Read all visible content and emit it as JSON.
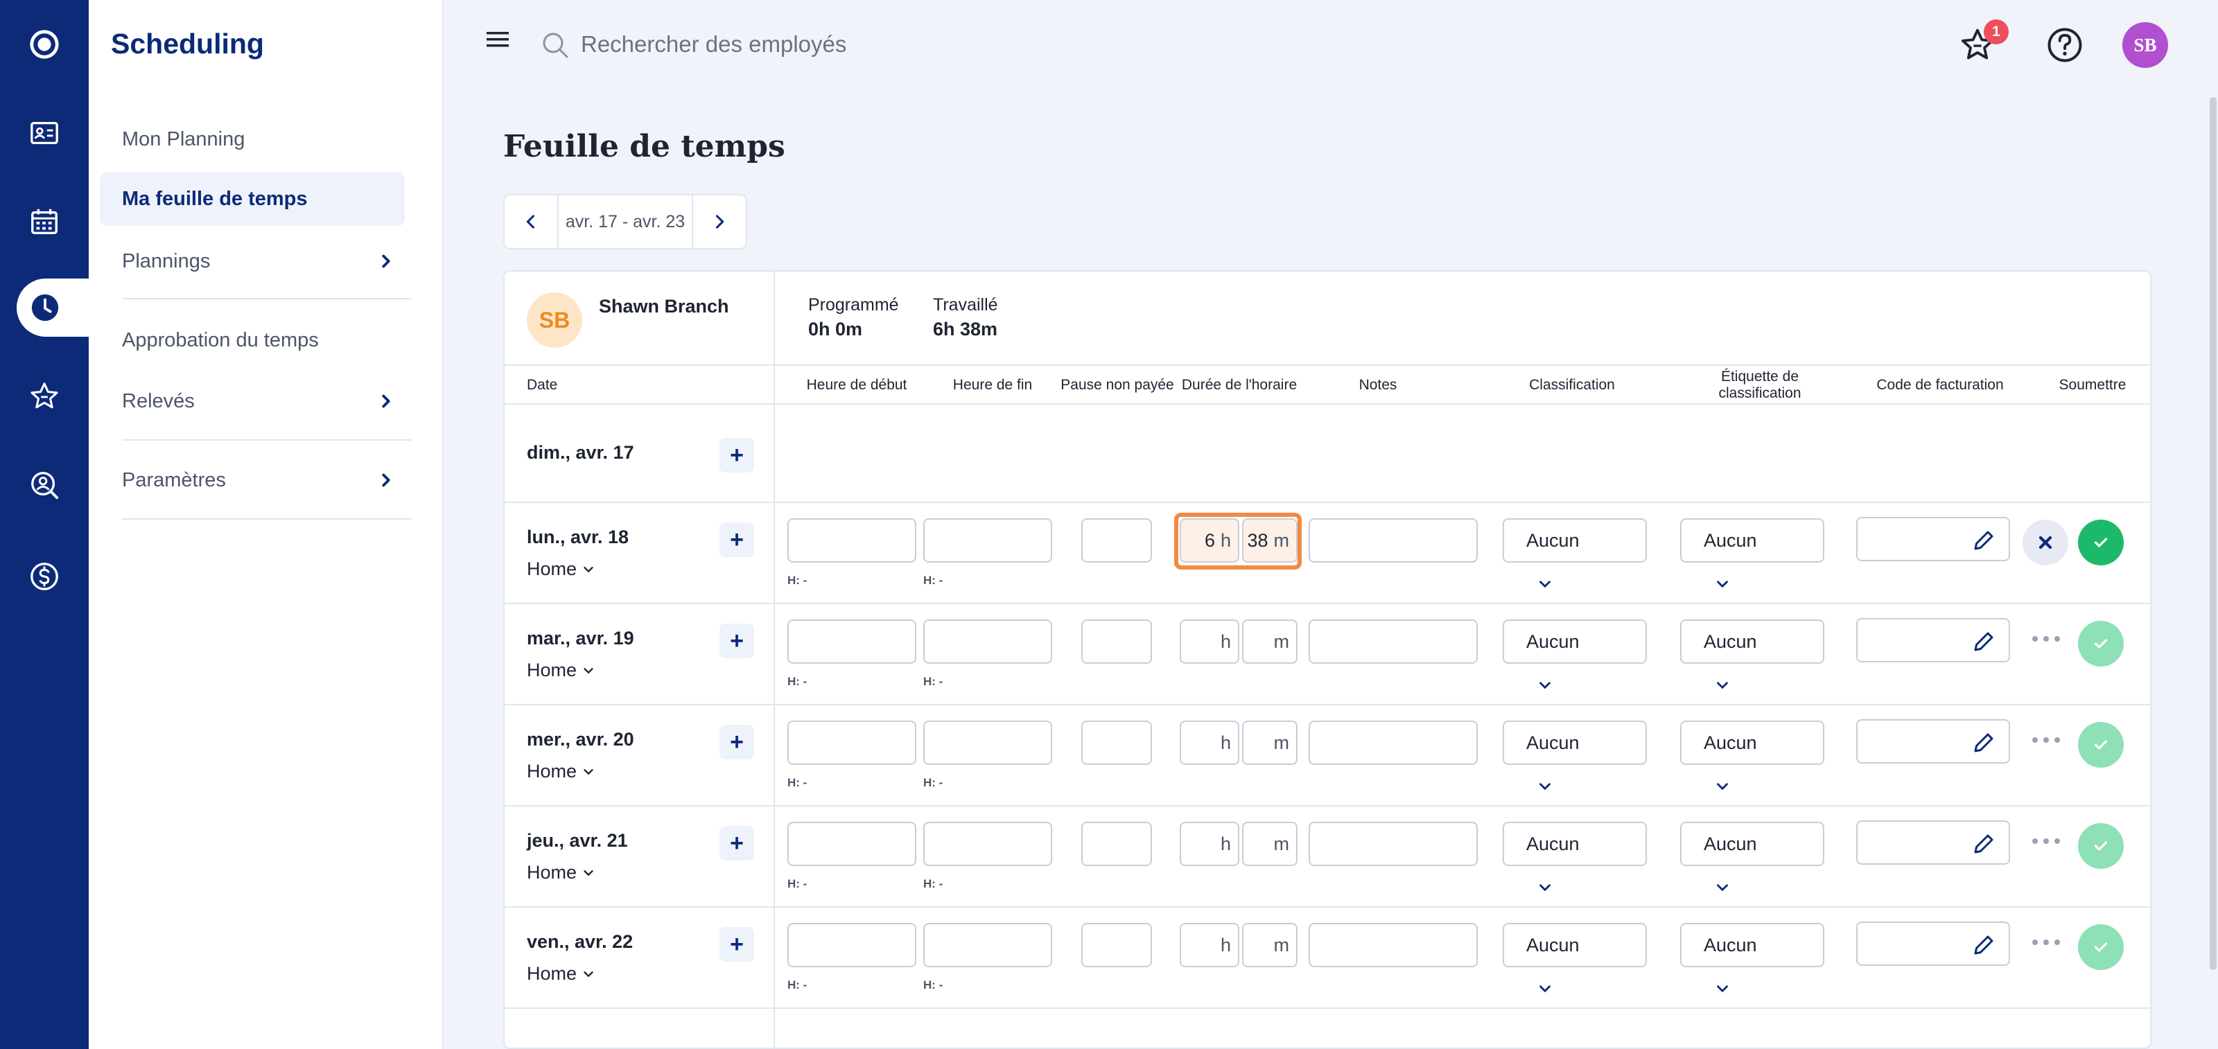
{
  "rail": {
    "icons": [
      "app-logo-icon",
      "id-card-icon",
      "calendar-icon",
      "clock-icon",
      "star-icon",
      "search-person-icon",
      "dollar-icon"
    ],
    "active": "clock-icon"
  },
  "sidebar": {
    "brand": "Scheduling",
    "items": [
      {
        "label": "Mon Planning"
      },
      {
        "label": "Ma feuille de temps"
      },
      {
        "label": "Plannings"
      },
      {
        "label": "Approbation du temps"
      },
      {
        "label": "Relevés"
      },
      {
        "label": "Paramètres"
      }
    ]
  },
  "topbar": {
    "search_placeholder": "Rechercher des employés",
    "notifications_count": "1",
    "avatar_initials": "SB"
  },
  "page": {
    "title": "Feuille de temps",
    "week_range": "avr. 17 - avr. 23"
  },
  "employee": {
    "initials": "SB",
    "name": "Shawn Branch",
    "scheduled_label": "Programmé",
    "scheduled_value": "0h 0m",
    "worked_label": "Travaillé",
    "worked_value": "6h 38m"
  },
  "columns": {
    "date": "Date",
    "start": "Heure de début",
    "end": "Heure de fin",
    "unpaid_break": "Pause non payée",
    "duration": "Durée de l'horaire",
    "notes": "Notes",
    "classification": "Classification",
    "classification_tag": "Étiquette de classification",
    "billing_code": "Code de facturation",
    "submit": "Soumettre"
  },
  "units": {
    "h": "h",
    "m": "m",
    "hint": "H: -"
  },
  "rows": [
    {
      "day": "dim., avr. 17",
      "location": ""
    },
    {
      "day": "lun., avr. 18",
      "location": "Home",
      "hours": "6",
      "minutes": "38",
      "classification": "Aucun",
      "tag": "Aucun"
    },
    {
      "day": "mar., avr. 19",
      "location": "Home",
      "hours": "",
      "minutes": "",
      "classification": "Aucun",
      "tag": "Aucun"
    },
    {
      "day": "mer., avr. 20",
      "location": "Home",
      "hours": "",
      "minutes": "",
      "classification": "Aucun",
      "tag": "Aucun"
    },
    {
      "day": "jeu., avr. 21",
      "location": "Home",
      "hours": "",
      "minutes": "",
      "classification": "Aucun",
      "tag": "Aucun"
    },
    {
      "day": "ven., avr. 22",
      "location": "Home",
      "hours": "",
      "minutes": "",
      "classification": "Aucun",
      "tag": "Aucun"
    }
  ],
  "colors": {
    "navy": "#0c2a78",
    "accent_orange": "#f08a43",
    "submit_green": "#1db96a",
    "submit_green_disabled": "#8ee0b6",
    "badge_red": "#ee4f5a",
    "avatar_purple": "#b04fcf"
  }
}
